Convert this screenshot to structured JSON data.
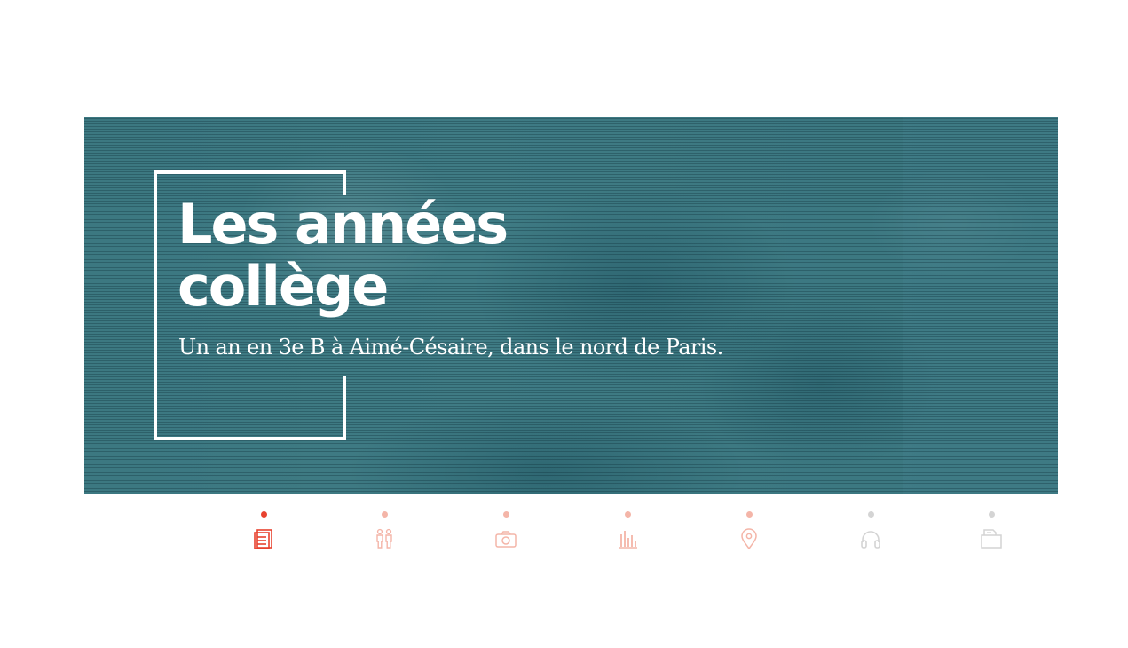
{
  "hero": {
    "title_line1": "Les années",
    "title_line2": "collège",
    "subtitle": "Un an en 3e B à Aimé-Césaire, dans le nord de Paris."
  },
  "colors": {
    "hero_bg": "#3f7b84",
    "active": "#e8422f",
    "inactive": "#f4b5a8",
    "disabled": "#d4d4d4"
  },
  "nav": {
    "items": [
      {
        "icon": "article-icon",
        "state": "active"
      },
      {
        "icon": "people-icon",
        "state": "inactive"
      },
      {
        "icon": "camera-icon",
        "state": "inactive"
      },
      {
        "icon": "bar-chart-icon",
        "state": "inactive"
      },
      {
        "icon": "map-pin-icon",
        "state": "inactive"
      },
      {
        "icon": "headphones-icon",
        "state": "disabled"
      },
      {
        "icon": "folder-icon",
        "state": "disabled"
      }
    ]
  }
}
